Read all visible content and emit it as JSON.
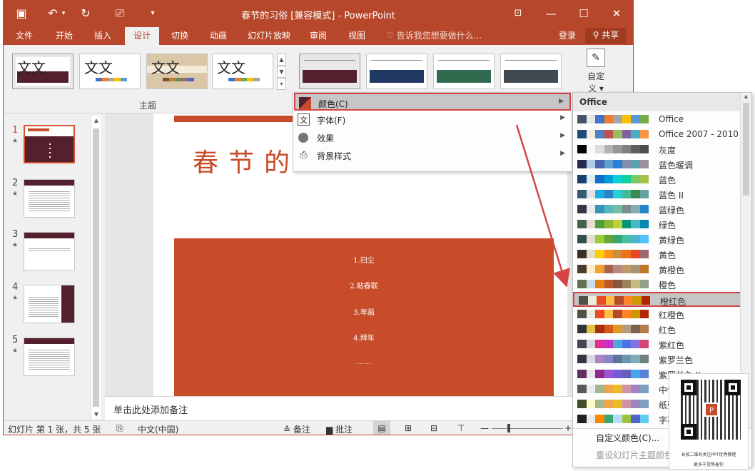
{
  "window": {
    "title": "春节的习俗 [兼容模式] - PowerPoint",
    "controls": {
      "restore_icon": "ribbon-display-icon",
      "minimize": "—",
      "maximize": "☐",
      "close": "✕"
    }
  },
  "quick_access": {
    "save": "💾",
    "undo": "↶",
    "undo_more": "▾",
    "redo": "↻",
    "present": "⎚",
    "customize": "▾"
  },
  "tabs": [
    "文件",
    "开始",
    "插入",
    "设计",
    "切换",
    "动画",
    "幻灯片放映",
    "审阅",
    "视图"
  ],
  "active_tab": "设计",
  "tell_me": "告诉我您想要做什么...",
  "login": "登录",
  "share": "共享",
  "ribbon": {
    "group_label": "主题",
    "themes": [
      {
        "text": "文文"
      },
      {
        "text": "文文"
      },
      {
        "text": "文文"
      },
      {
        "text": "文文"
      }
    ],
    "custom_label_1": "自定",
    "custom_label_2": "义 ▾"
  },
  "slides": [
    {
      "num": "1",
      "star": "★"
    },
    {
      "num": "2",
      "star": "★"
    },
    {
      "num": "3",
      "star": "★"
    },
    {
      "num": "4",
      "star": "★"
    },
    {
      "num": "5",
      "star": "★"
    }
  ],
  "slide": {
    "title": "春节的",
    "bullets": [
      "1.扫尘",
      "2.贴春联",
      "3.年画",
      "4.拜年",
      "……"
    ]
  },
  "notes_placeholder": "单击此处添加备注",
  "status": {
    "slide_info": "幻灯片 第 1 张，共 5 张",
    "language": "中文(中国)",
    "notes": "备注",
    "comments": "批注",
    "zoom_minus": "—",
    "zoom_plus": "+"
  },
  "menu": {
    "items": [
      {
        "label": "颜色(C)",
        "icon": "color-icon"
      },
      {
        "label": "字体(F)",
        "icon": "font-icon"
      },
      {
        "label": "效果",
        "icon": "effects-icon"
      },
      {
        "label": "背景样式",
        "icon": "background-icon"
      }
    ]
  },
  "color_gallery": {
    "header": "Office",
    "schemes": [
      {
        "name": "Office",
        "colors": [
          "#44546a",
          "#e7e6e6",
          "#4472c4",
          "#ed7d31",
          "#a5a5a5",
          "#ffc000",
          "#5b9bd5",
          "#70ad47"
        ]
      },
      {
        "name": "Office 2007 - 2010",
        "colors": [
          "#1f497d",
          "#eeece1",
          "#4f81bd",
          "#c0504d",
          "#9bbb59",
          "#8064a2",
          "#4bacc6",
          "#f79646"
        ]
      },
      {
        "name": "灰度",
        "colors": [
          "#000000",
          "#f8f8f8",
          "#dddddd",
          "#b2b2b2",
          "#969696",
          "#808080",
          "#5f5f5f",
          "#4d4d4d"
        ]
      },
      {
        "name": "蓝色暖调",
        "colors": [
          "#242852",
          "#acccea",
          "#4a66ac",
          "#629dd1",
          "#297fd5",
          "#7f8fa9",
          "#5aa2ae",
          "#9d90a0"
        ]
      },
      {
        "name": "蓝色",
        "colors": [
          "#17406d",
          "#dbefef",
          "#0f6fc6",
          "#009dd9",
          "#0bd0d9",
          "#10cf9b",
          "#7cca62",
          "#a5c249"
        ]
      },
      {
        "name": "蓝色 II",
        "colors": [
          "#335b74",
          "#dfe3e5",
          "#1cade4",
          "#2683c6",
          "#27ced7",
          "#42ba97",
          "#3e8853",
          "#62a39f"
        ]
      },
      {
        "name": "蓝绿色",
        "colors": [
          "#373545",
          "#ebebeb",
          "#3494ba",
          "#58b6c0",
          "#75bda7",
          "#7a8c8e",
          "#84acb6",
          "#2683c6"
        ]
      },
      {
        "name": "绿色",
        "colors": [
          "#455f51",
          "#e3ded1",
          "#549e39",
          "#8ab833",
          "#c0cf3a",
          "#029676",
          "#4ab5c4",
          "#0989b1"
        ]
      },
      {
        "name": "黄绿色",
        "colors": [
          "#2f4f4f",
          "#e3ded1",
          "#99cb38",
          "#63a537",
          "#37a76f",
          "#44c1a3",
          "#4eb3cf",
          "#51c3f9"
        ]
      },
      {
        "name": "黄色",
        "colors": [
          "#39302a",
          "#e5dec5",
          "#ffca08",
          "#f8931d",
          "#ce8d3e",
          "#ec7016",
          "#e64823",
          "#9c6a6a"
        ]
      },
      {
        "name": "黄橙色",
        "colors": [
          "#4e3b30",
          "#fbeec9",
          "#f0a22e",
          "#a5644e",
          "#b58b80",
          "#c3986d",
          "#a19574",
          "#c17529"
        ]
      },
      {
        "name": "橙色",
        "colors": [
          "#637052",
          "#ccddea",
          "#e48312",
          "#bd582c",
          "#865640",
          "#9b8357",
          "#c2bc80",
          "#94a088"
        ]
      },
      {
        "name": "橙红色",
        "colors": [
          "#505046",
          "#eeece1",
          "#e84c22",
          "#ffbd47",
          "#b64926",
          "#ff8427",
          "#cc9900",
          "#b22600"
        ]
      },
      {
        "name": "红橙色",
        "colors": [
          "#505046",
          "#eeece1",
          "#e84c22",
          "#ffbd47",
          "#b64926",
          "#ff8427",
          "#cc9900",
          "#b22600"
        ]
      },
      {
        "name": "红色",
        "colors": [
          "#323232",
          "#e5c243",
          "#a5300f",
          "#d55816",
          "#e19825",
          "#b19c7d",
          "#7f5f52",
          "#b27d49"
        ]
      },
      {
        "name": "紫红色",
        "colors": [
          "#454551",
          "#d8d9dc",
          "#e32d91",
          "#c830cc",
          "#4ea6dc",
          "#4775e7",
          "#8971e1",
          "#d54773"
        ]
      },
      {
        "name": "紫罗兰色",
        "colors": [
          "#373545",
          "#dcd8dc",
          "#ad84c6",
          "#8784c7",
          "#5d739a",
          "#6997af",
          "#84acb6",
          "#6f8183"
        ]
      },
      {
        "name": "紫罗兰色 II",
        "colors": [
          "#632e62",
          "#eae5eb",
          "#92278f",
          "#9b57d3",
          "#755dd9",
          "#665eb8",
          "#45a5ed",
          "#5982db"
        ]
      },
      {
        "name": "中性",
        "colors": [
          "#595959",
          "#ececec",
          "#a5b592",
          "#f3a447",
          "#e7bc29",
          "#d092a7",
          "#9c85c0",
          "#809ec2"
        ]
      },
      {
        "name": "纸张",
        "colors": [
          "#444d26",
          "#fefac9",
          "#a5b592",
          "#f3a447",
          "#e7bc29",
          "#d092a7",
          "#9c85c0",
          "#809ec2"
        ]
      },
      {
        "name": "字幕",
        "colors": [
          "#1f2123",
          "#ebebeb",
          "#ff8600",
          "#37a76f",
          "#b4dcfa",
          "#9bc63b",
          "#4e67c8",
          "#5eccf3"
        ]
      }
    ],
    "selected": "橙红色",
    "footer_customize": "自定义颜色(C)...",
    "footer_reset": "重设幻灯片主题颜色(R)"
  },
  "qr_card": {
    "caption": "长按二维码关注PPT优秀教程",
    "subcaption": "更多干货等着你"
  }
}
